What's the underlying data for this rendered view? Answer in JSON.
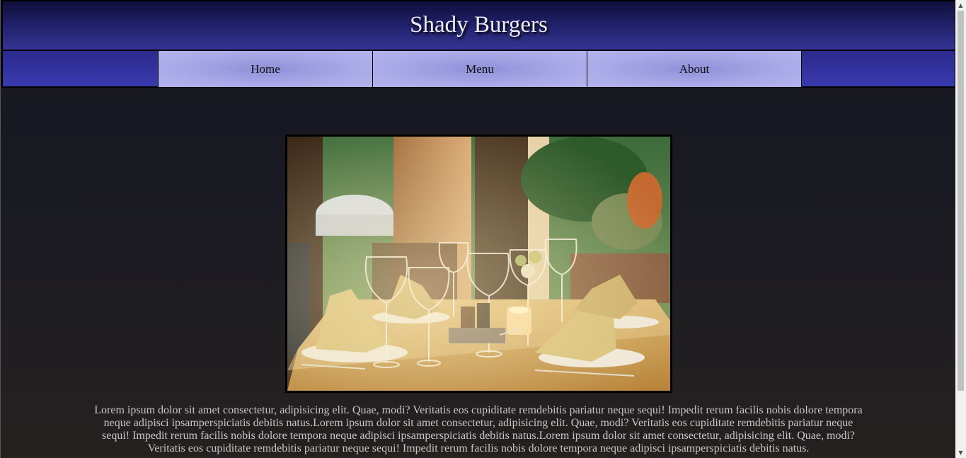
{
  "header": {
    "title": "Shady Burgers"
  },
  "nav": {
    "items": [
      {
        "label": "Home"
      },
      {
        "label": "Menu"
      },
      {
        "label": "About"
      }
    ]
  },
  "main": {
    "hero_image": {
      "alt": "restaurant table setting with wine glasses and napkins"
    },
    "paragraph": "Lorem ipsum dolor sit amet consectetur, adipisicing elit. Quae, modi? Veritatis eos cupiditate remdebitis pariatur neque sequi! Impedit rerum facilis nobis dolore tempora neque adipisci ipsamperspiciatis debitis natus.Lorem ipsum dolor sit amet consectetur, adipisicing elit. Quae, modi? Veritatis eos cupiditate remdebitis pariatur neque sequi! Impedit rerum facilis nobis dolore tempora neque adipisci ipsamperspiciatis debitis natus.Lorem ipsum dolor sit amet consectetur, adipisicing elit. Quae, modi? Veritatis eos cupiditate remdebitis pariatur neque sequi! Impedit rerum facilis nobis dolore tempora neque adipisci ipsamperspiciatis debitis natus."
  },
  "colors": {
    "header_bg": "#1f1f66",
    "nav_bg": "#3a3ab0",
    "nav_item_bg": "#aaaae8",
    "page_bg": "#1a1a23",
    "text": "#c8c5cc"
  },
  "scrollbar": {
    "up_icon": "scroll-up-arrow",
    "down_icon": "scroll-down-arrow"
  }
}
